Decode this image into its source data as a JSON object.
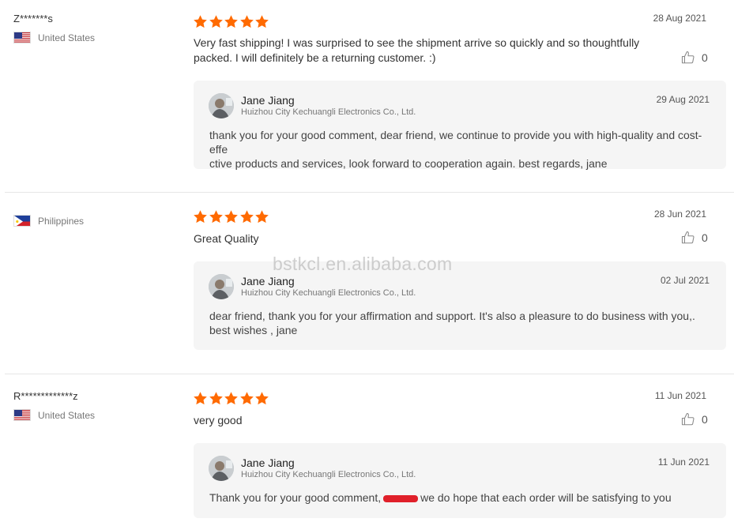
{
  "colors": {
    "star": "#ff6a00",
    "text": "#333333",
    "muted": "#777777",
    "reply_bg": "#f5f5f5"
  },
  "icons": {
    "star": "star-icon",
    "like": "thumbs-up-icon",
    "flag_us": "flag-us-icon",
    "flag_ph": "flag-philippines-icon"
  },
  "watermark": "bstkcl.en.alibaba.com",
  "reviews": [
    {
      "buyer": "Z*******s",
      "country": "United States",
      "rating": 5,
      "date": "28 Aug 2021",
      "comment_lines": [
        "Very fast shipping! I was surprised to see the shipment arrive so quickly and so thoughtfully",
        "packed. I will definitely be a returning customer. :)"
      ],
      "likes": "0",
      "reply": {
        "name": "Jane Jiang",
        "company": "Huizhou City Kechuangli Electronics Co., Ltd.",
        "date": "29 Aug 2021",
        "lines": [
          "thank you for your good comment, dear friend, we continue to provide you with high-quality and cost-effe",
          "ctive products and services, look forward to cooperation again. best regards, jane"
        ]
      }
    },
    {
      "buyer": "",
      "country": "Philippines",
      "rating": 5,
      "date": "28 Jun 2021",
      "comment_lines": [
        "Great Quality"
      ],
      "likes": "0",
      "reply": {
        "name": "Jane Jiang",
        "company": "Huizhou City Kechuangli Electronics Co., Ltd.",
        "date": "02 Jul 2021",
        "lines": [
          "dear friend, thank you for your affirmation and support. It's also a pleasure to do business with you,.",
          "best wishes , jane"
        ]
      }
    },
    {
      "buyer": "R*************z",
      "country": "United States",
      "rating": 5,
      "date": "11 Jun 2021",
      "comment_lines": [
        "very good"
      ],
      "likes": "0",
      "reply": {
        "name": "Jane Jiang",
        "company": "Huizhou City Kechuangli Electronics Co., Ltd.",
        "date": "11 Jun 2021",
        "text_before": "Thank you for your good comment,",
        "text_after": "we do  hope that each order will be satisfying to you"
      }
    }
  ]
}
